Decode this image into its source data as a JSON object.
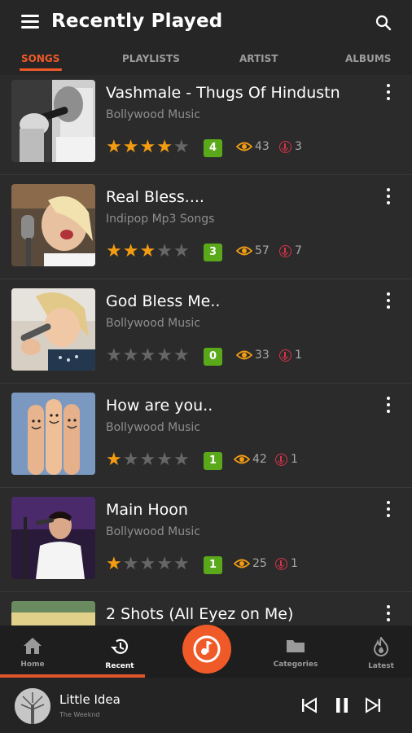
{
  "header": {
    "title": "Recently Played"
  },
  "tabs": [
    {
      "label": "SONGS",
      "active": true
    },
    {
      "label": "PLAYLISTS",
      "active": false
    },
    {
      "label": "ARTIST",
      "active": false
    },
    {
      "label": "ALBUMS",
      "active": false
    }
  ],
  "songs": [
    {
      "title": "Vashmale - Thugs Of Hindustn",
      "category": "Bollywood Music",
      "rating": 4,
      "rating_label": "4",
      "views": "43",
      "downloads": "3"
    },
    {
      "title": "Real Bless....",
      "category": "Indipop Mp3 Songs",
      "rating": 3,
      "rating_label": "3",
      "views": "57",
      "downloads": "7"
    },
    {
      "title": "God Bless Me..",
      "category": "Bollywood Music",
      "rating": 0,
      "rating_label": "0",
      "views": "33",
      "downloads": "1"
    },
    {
      "title": "How are you..",
      "category": "Bollywood Music",
      "rating": 1,
      "rating_label": "1",
      "views": "42",
      "downloads": "1"
    },
    {
      "title": "Main Hoon",
      "category": "Bollywood Music",
      "rating": 1,
      "rating_label": "1",
      "views": "25",
      "downloads": "1"
    },
    {
      "title": "2 Shots (All Eyez on Me)",
      "category": "",
      "rating": 0,
      "rating_label": "",
      "views": "",
      "downloads": ""
    }
  ],
  "bottom_nav": {
    "home": "Home",
    "recent": "Recent",
    "categories": "Categories",
    "latest": "Latest"
  },
  "player": {
    "title": "Little Idea",
    "artist": "The Weeknd"
  },
  "colors": {
    "accent": "#f05a28",
    "star": "#f39c12",
    "badge": "#5aa91a",
    "download": "#d9334a"
  }
}
